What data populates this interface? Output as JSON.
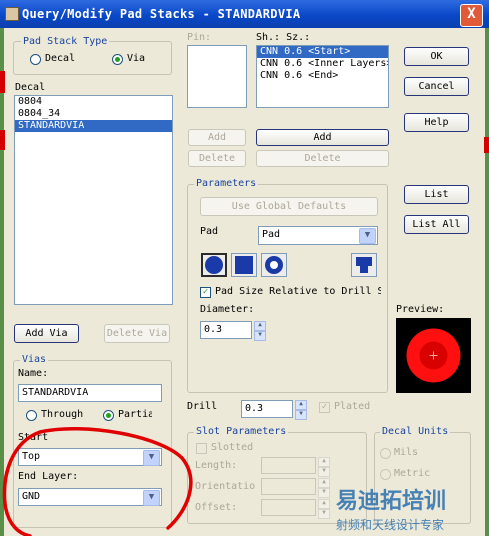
{
  "window": {
    "title": "Query/Modify Pad Stacks - STANDARDVIA",
    "close_glyph": "X"
  },
  "pad_stack_type": {
    "label": "Pad Stack Type",
    "options": [
      "Decal",
      "Via"
    ],
    "selected": "Via"
  },
  "decal": {
    "label": "Decal",
    "items": [
      "0804",
      "0804_34",
      "STANDARDVIA"
    ],
    "selected_index": 2
  },
  "buttons": {
    "add_via": "Add Via",
    "delete_via": "Delete Via",
    "add_small": "Add",
    "delete_small": "Delete",
    "add_wide": "Add",
    "delete_wide": "Delete",
    "ok": "OK",
    "cancel": "Cancel",
    "help": "Help",
    "list": "List",
    "list_all": "List All"
  },
  "pin": {
    "label": "Pin:"
  },
  "sh_sz": {
    "label": "Sh.: Sz.:",
    "items": [
      "CNN 0.6 <Start>",
      "CNN 0.6 <Inner Layers>",
      "CNN 0.6 <End>"
    ],
    "selected_index": 0
  },
  "parameters": {
    "label": "Parameters",
    "use_global_defaults": "Use Global Defaults",
    "pad_label": "Pad",
    "pad_combo_value": "Pad",
    "pad_size_relative": "Pad Size Relative to Drill Size",
    "pad_size_relative_checked": true,
    "diameter_label": "Diameter:",
    "diameter_value": "0.3"
  },
  "drill": {
    "label": "Drill",
    "value": "0.3",
    "plated_label": "Plated",
    "plated_checked": true
  },
  "preview": {
    "label": "Preview:"
  },
  "vias": {
    "label": "Vias",
    "name_label": "Name:",
    "name_value": "STANDARDVIA",
    "through_label": "Through",
    "partial_label": "Partial",
    "selected": "Partial",
    "start_label": "Start",
    "start_value": "Top",
    "end_layer_label": "End Layer:",
    "end_layer_value": "GND"
  },
  "slot_parameters": {
    "label": "Slot Parameters",
    "slotted_label": "Slotted",
    "length_label": "Length:",
    "orientation_label": "Orientation:",
    "offset_label": "Offset:"
  },
  "decal_units": {
    "label": "Decal Units",
    "mils_label": "Mils",
    "metric_label": "Metric"
  },
  "watermark": {
    "line1": "易迪拓培训",
    "line2": "射频和天线设计专家"
  },
  "colors": {
    "titlebar": "#0a48c8",
    "selection": "#316ac5",
    "annotation_red": "#d40000",
    "preview_pad": "#ff0000",
    "watermark": "#2a6fb0"
  }
}
